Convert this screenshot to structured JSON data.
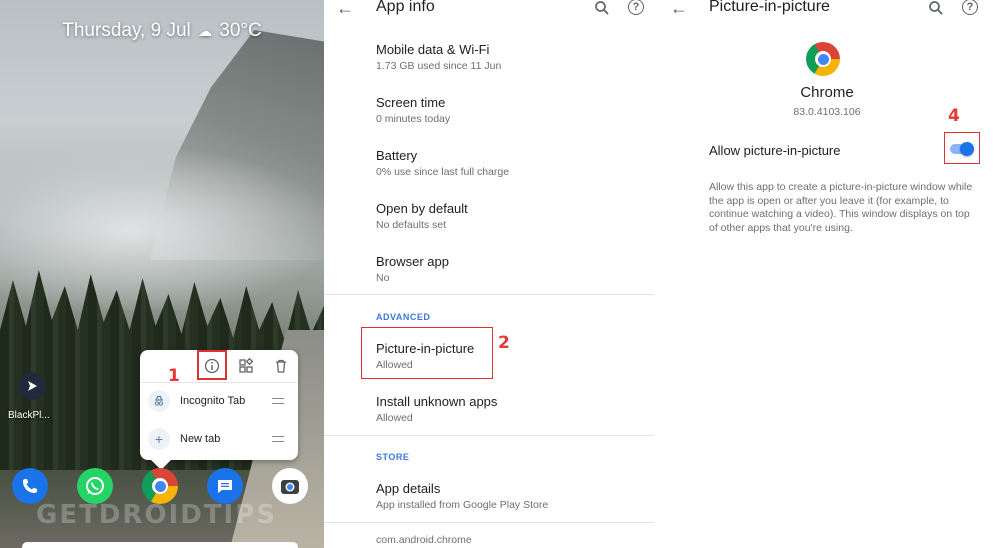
{
  "home": {
    "date_weather": {
      "date": "Thursday, 9 Jul",
      "cloud_icon": "cloud-icon",
      "temp": "30°C"
    },
    "side_app": {
      "label": "BlackPl..."
    },
    "popup": {
      "step_label": "1",
      "top_icons": [
        "info-icon",
        "widgets-icon",
        "trash-icon"
      ],
      "items": [
        {
          "label": "Incognito Tab",
          "icon": "incognito-icon"
        },
        {
          "label": "New tab",
          "icon": "+"
        }
      ]
    },
    "dock": [
      "phone-app",
      "whatsapp-app",
      "chrome-app",
      "messages-app",
      "camera-app"
    ],
    "watermark": "GETDROIDTIPS"
  },
  "app_info": {
    "title": "App info",
    "items": [
      {
        "title": "Mobile data & Wi-Fi",
        "subtitle": "1.73 GB used since 11 Jun"
      },
      {
        "title": "Screen time",
        "subtitle": "0 minutes today"
      },
      {
        "title": "Battery",
        "subtitle": "0% use since last full charge"
      },
      {
        "title": "Open by default",
        "subtitle": "No defaults set"
      },
      {
        "title": "Browser app",
        "subtitle": "No"
      }
    ],
    "advanced_label": "ADVANCED",
    "advanced_items": [
      {
        "title": "Picture-in-picture",
        "subtitle": "Allowed"
      },
      {
        "title": "Install unknown apps",
        "subtitle": "Allowed"
      }
    ],
    "step_label": "2",
    "store_label": "STORE",
    "store_item": {
      "title": "App details",
      "subtitle": "App installed from Google Play Store"
    },
    "package": "com.android.chrome"
  },
  "pip": {
    "title": "Picture-in-picture",
    "app_name": "Chrome",
    "version": "83.0.4103.106",
    "allow_label": "Allow picture-in-picture",
    "toggle_on": true,
    "step_label": "4",
    "description": "Allow this app to create a picture-in-picture window while the app is open or after you leave it (for example, to continue watching a video). This window displays on top of other apps that you're using."
  },
  "colors": {
    "accent": "#1a73e8",
    "annotation": "#e53935",
    "section": "#3c78d8"
  }
}
